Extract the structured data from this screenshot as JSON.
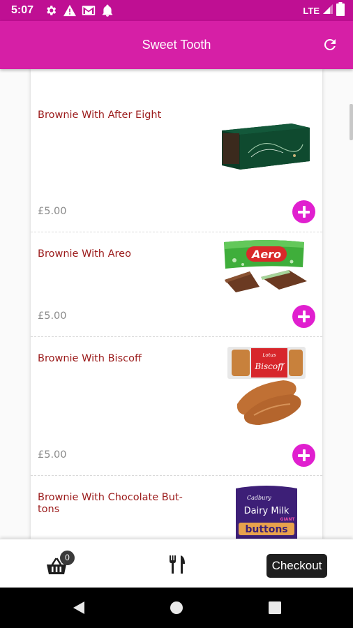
{
  "status_bar": {
    "time": "5:07",
    "network": "LTE",
    "icons": [
      "settings-icon",
      "warning-icon",
      "gmail-icon",
      "notification-bell-icon",
      "signal-icon",
      "battery-icon"
    ]
  },
  "app_bar": {
    "title": "Sweet Tooth",
    "refresh_icon": "refresh-icon"
  },
  "products": [
    {
      "name": "Brownie With After Eight",
      "price": "£5.00",
      "image": "after-eight-box"
    },
    {
      "name": "Brownie With Areo",
      "price": "£5.00",
      "image": "aero-mint-bar"
    },
    {
      "name": "Brownie With Biscoff",
      "price": "£5.00",
      "image": "biscoff-biscuits"
    },
    {
      "name": "Brownie With Chocolate But-tons",
      "price": "",
      "image": "dairy-milk-buttons"
    }
  ],
  "product_images_text": {
    "aero": "Aero",
    "biscoff_brand": "Lotus",
    "biscoff": "Biscoff",
    "cadbury": "Cadbury",
    "dairy_milk": "Dairy Milk",
    "giant": "GIANT",
    "buttons": "buttons"
  },
  "bottom_bar": {
    "cart_count": "0",
    "checkout_label": "Checkout",
    "icons": [
      "basket-icon",
      "cutlery-icon"
    ]
  },
  "colors": {
    "status_bar": "#bf0f93",
    "app_bar": "#d61fa6",
    "product_name": "#9b1b1b",
    "add_button": "#e01fcf",
    "checkout": "#1f1f1f"
  }
}
